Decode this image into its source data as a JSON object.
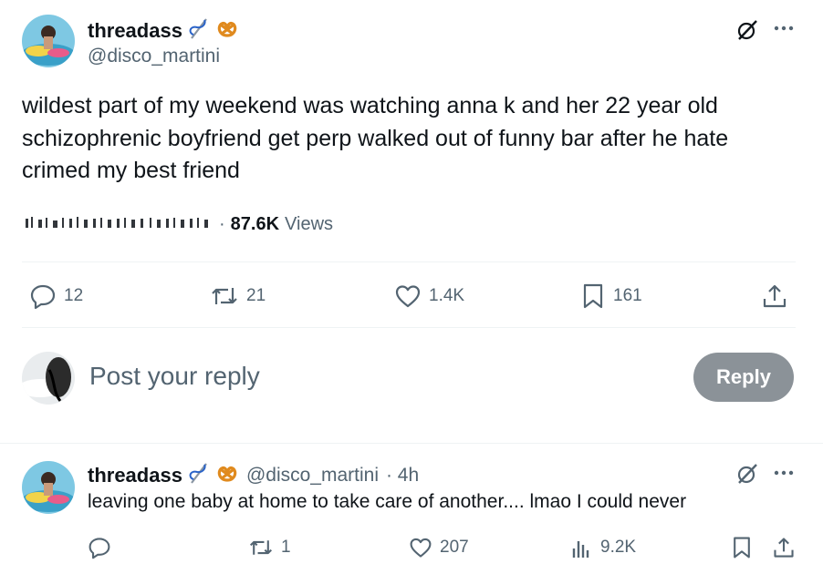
{
  "main_post": {
    "display_name": "threadass",
    "handle": "@disco_martini",
    "text_line1": "wildest part of my weekend was watching anna k and her 22 year old",
    "text_line2": "schizophrenic boyfriend get perp walked out of funny bar after he hate",
    "text_line3": "crimed my best friend",
    "time_separator": "·",
    "views_count": "87.6K",
    "views_label": "Views",
    "replies": "12",
    "reposts": "21",
    "likes": "1.4K",
    "bookmarks": "161"
  },
  "composer": {
    "placeholder": "Post your reply",
    "button_label": "Reply"
  },
  "reply_post": {
    "display_name": "threadass",
    "handle": "@disco_martini",
    "time": "· 4h",
    "text": "leaving one baby at home to take care of another.... lmao I could never",
    "replies": "",
    "reposts": "1",
    "likes": "207",
    "views": "9.2K"
  },
  "colors": {
    "text": "#0f1419",
    "muted": "#536471",
    "divider": "#eff3f4",
    "reply_button": "#8b9298"
  }
}
